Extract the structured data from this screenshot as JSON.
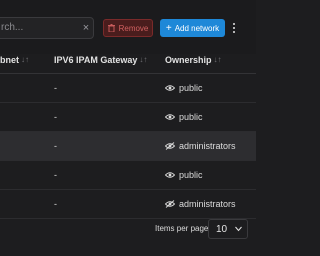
{
  "toolbar": {
    "search_placeholder": "rch...",
    "clear_label": "×",
    "remove_label": "Remove",
    "add_label": "Add network"
  },
  "table": {
    "headers": [
      {
        "label": "bnet",
        "sort": "↓↑"
      },
      {
        "label": "IPV6 IPAM Gateway",
        "sort": "↓↑"
      },
      {
        "label": "Ownership",
        "sort": "↓↑"
      }
    ],
    "rows": [
      {
        "c1": "",
        "gateway": "-",
        "ownership": "public",
        "icon": "eye-icon",
        "selected": false
      },
      {
        "c1": "",
        "gateway": "-",
        "ownership": "public",
        "icon": "eye-icon",
        "selected": false
      },
      {
        "c1": "",
        "gateway": "-",
        "ownership": "administrators",
        "icon": "eye-slash-icon",
        "selected": true
      },
      {
        "c1": "",
        "gateway": "-",
        "ownership": "public",
        "icon": "eye-icon",
        "selected": false
      },
      {
        "c1": "",
        "gateway": "-",
        "ownership": "administrators",
        "icon": "eye-slash-icon",
        "selected": false
      }
    ]
  },
  "pagination": {
    "items_per_page_label": "Items per page",
    "items_per_page_value": "10"
  },
  "colors": {
    "accent": "#1e88d8",
    "danger": "#d06060",
    "background": "#1d1d1f"
  }
}
